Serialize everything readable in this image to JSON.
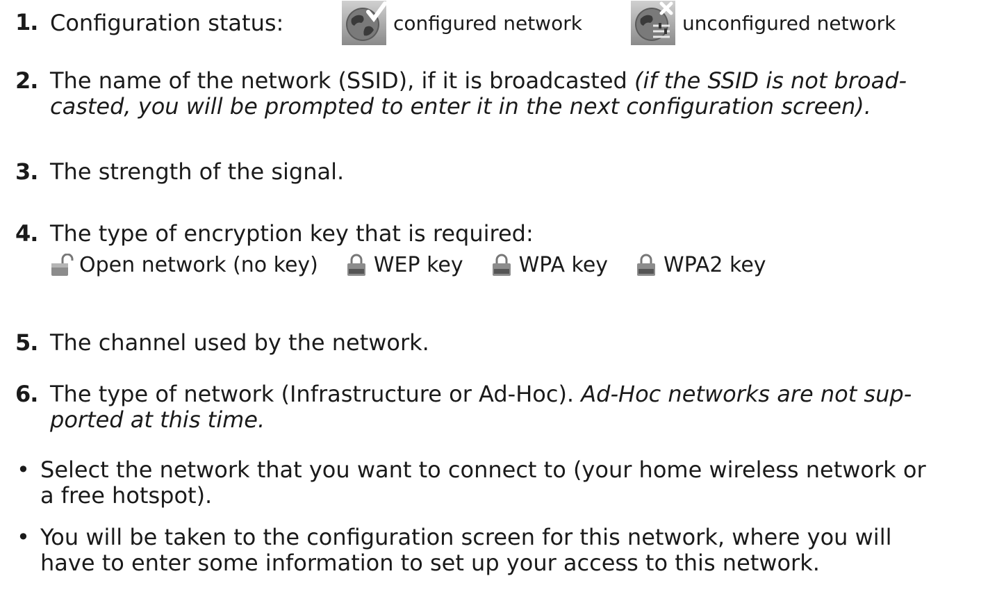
{
  "items": [
    {
      "num": "1.",
      "label": "Configuration status:",
      "legend": [
        {
          "icon": "configured-network-icon",
          "text": "configured network"
        },
        {
          "icon": "unconfigured-network-icon",
          "text": "unconfigured network"
        }
      ]
    },
    {
      "num": "2.",
      "text": "The name of the network (SSID), if it is broadcasted ",
      "italic": "(if the SSID is not broad-",
      "italic2": "casted, you will be prompted to enter it in the next configuration screen)."
    },
    {
      "num": "3.",
      "text": "The strength of the signal."
    },
    {
      "num": "4.",
      "text": "The type of encryption key that is required:",
      "keys": [
        {
          "icon": "open-lock-icon",
          "text": "Open network (no key)"
        },
        {
          "icon": "wep-lock-icon",
          "text": "WEP key"
        },
        {
          "icon": "wpa-lock-icon",
          "text": "WPA key"
        },
        {
          "icon": "wpa2-lock-icon",
          "text": "WPA2 key"
        }
      ]
    },
    {
      "num": "5.",
      "text": "The channel used by the network."
    },
    {
      "num": "6.",
      "text": "The type of network (Infrastructure or Ad-Hoc). ",
      "italic": "Ad-Hoc networks are not sup-",
      "italic2": "ported at this time."
    }
  ],
  "bullets": [
    {
      "line1": "Select the network that you want to connect to (your home wireless network or",
      "line2": "a free hotspot)."
    },
    {
      "line1": "You will be taken to the configuration screen for this network, where you will",
      "line2": "have to enter some information to set up your access to this network."
    }
  ],
  "bullet_char": "•"
}
